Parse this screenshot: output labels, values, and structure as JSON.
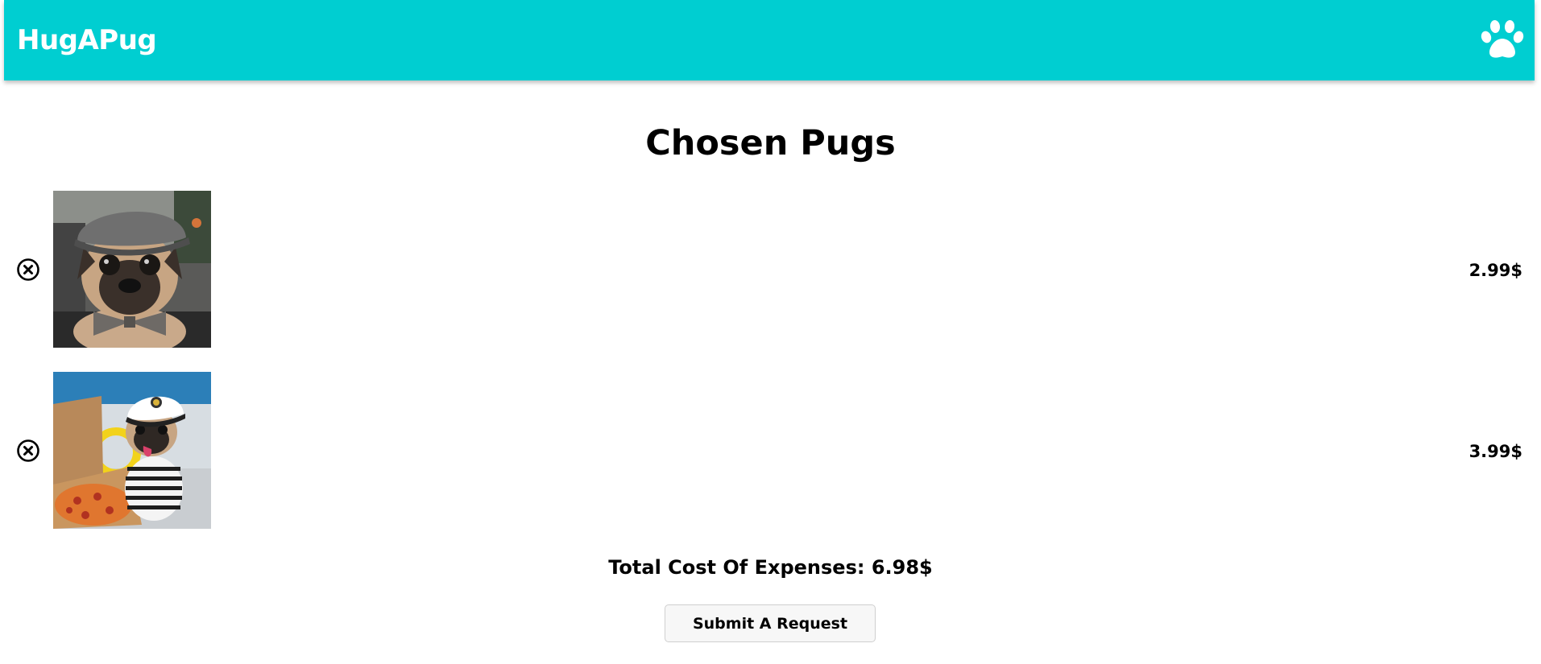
{
  "header": {
    "brand": "HugAPug",
    "brand_color": "#00ced1",
    "icon": "paw-icon"
  },
  "main": {
    "title": "Chosen Pugs",
    "items": [
      {
        "image": "pug wearing a grey flat cap and plaid bow tie in a car",
        "remove_icon": "remove-circle-x-icon",
        "price": "2.99$"
      },
      {
        "image": "pug in a captain hat and striped shirt on a boat with pizza",
        "remove_icon": "remove-circle-x-icon",
        "price": "3.99$"
      }
    ],
    "total_label": "Total Cost Of Expenses:",
    "total_value": "6.98$",
    "submit_label": "Submit A Request"
  }
}
